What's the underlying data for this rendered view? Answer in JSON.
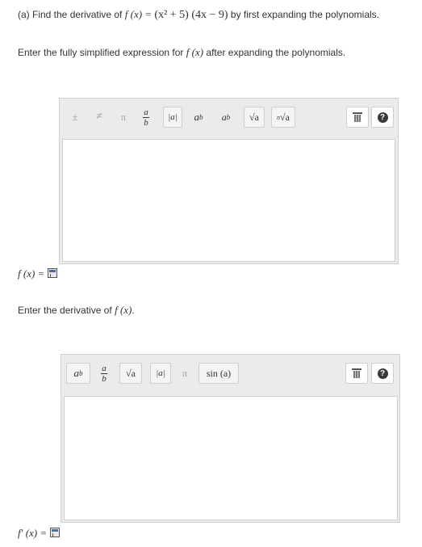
{
  "question_a": {
    "prefix": "(a) Find the derivative of",
    "f_of_x": "f (x) =",
    "expr": "(x² + 5) (4x − 9)",
    "suffix": "by first expanding the polynomials."
  },
  "instruction_1": {
    "text": "Enter the fully simplified expression for",
    "f_of_x": "f (x)",
    "suffix": "after expanding the polynomials."
  },
  "toolbar_1": {
    "buttons": [
      "±",
      "≠",
      "π",
      "a/b",
      "|a|",
      "aᵇ",
      "a_b",
      "√a",
      "ⁿ√a"
    ],
    "plusminus": "±",
    "neq": "≠",
    "pi": "π",
    "frac_num": "a",
    "frac_den": "b",
    "abs": "|a|",
    "power_base": "a",
    "power_exp": "b",
    "sub_base": "a",
    "sub_sub": "b",
    "sqrt": "√a",
    "nroot_n": "n",
    "nroot": "√a",
    "help": "?"
  },
  "answer_1_label": "f (x) =",
  "instruction_2": {
    "text": "Enter the derivative of",
    "f_of_x": "f (x)",
    "suffix": "."
  },
  "toolbar_2": {
    "power_base": "a",
    "power_exp": "b",
    "frac_num": "a",
    "frac_den": "b",
    "sqrt": "√a",
    "abs": "|a|",
    "pi": "π",
    "sin": "sin (a)",
    "help": "?"
  },
  "answer_2_label": "f′ (x) ="
}
